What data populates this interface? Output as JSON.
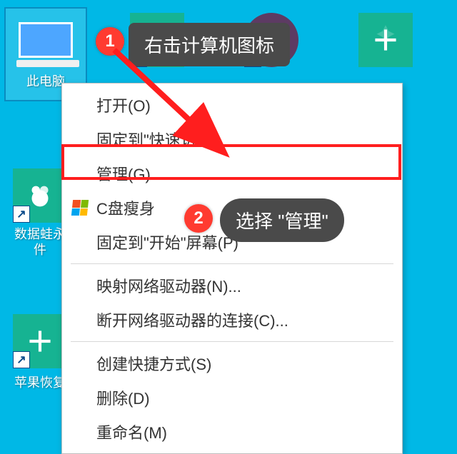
{
  "desktop": {
    "this_pc": {
      "label": "此电脑"
    },
    "data_frog": {
      "label": "数据蛙恢复软件",
      "label_short": "数据蛙永久\n件"
    },
    "apple_recover": {
      "label": "苹果恢复"
    }
  },
  "context_menu": {
    "open": "打开(O)",
    "pin_quick_access": "固定到\"快速访问\"",
    "manage": "管理(G)",
    "c_slim": "C盘瘦身",
    "pin_start": "固定到\"开始\"屏幕(P)",
    "map_drive": "映射网络驱动器(N)...",
    "disconnect_drive": "断开网络驱动器的连接(C)...",
    "create_shortcut": "创建快捷方式(S)",
    "delete": "删除(D)",
    "rename": "重命名(M)"
  },
  "annotations": {
    "step1_badge": "1",
    "step1_text": "右击计算机图标",
    "step2_badge": "2",
    "step2_text": "选择 \"管理\""
  }
}
